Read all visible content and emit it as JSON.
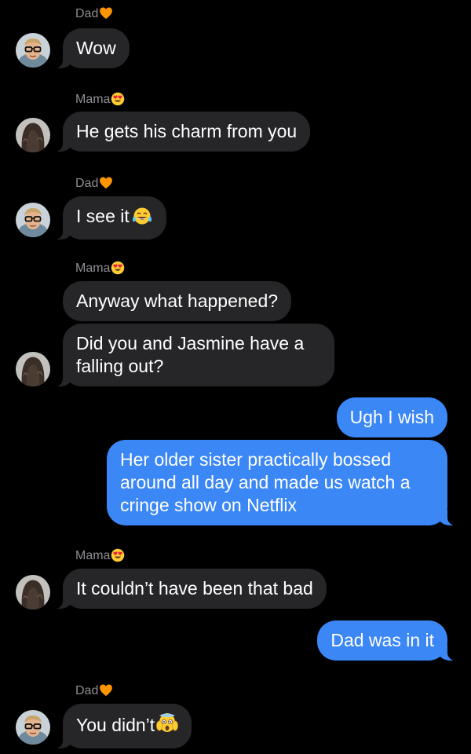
{
  "colors": {
    "background": "#000000",
    "incoming_bubble": "#262629",
    "outgoing_bubble": "#3b87f5",
    "sender_name": "#8e8e93"
  },
  "messages": [
    {
      "sender": "Dad",
      "sender_emoji": "orange-heart-icon",
      "text": "Wow",
      "direction": "incoming"
    },
    {
      "sender": "Mama",
      "sender_emoji": "heart-eyes-icon",
      "text": "He gets his charm from you",
      "direction": "incoming"
    },
    {
      "sender": "Dad",
      "sender_emoji": "orange-heart-icon",
      "text": "I see it",
      "trailing_emoji": "tears-of-joy-icon",
      "direction": "incoming"
    },
    {
      "sender": "Mama",
      "sender_emoji": "heart-eyes-icon",
      "text": "Anyway what happened?",
      "direction": "incoming"
    },
    {
      "text": "Did you and Jasmine have a falling out?",
      "direction": "incoming"
    },
    {
      "text": "Ugh I wish",
      "direction": "outgoing"
    },
    {
      "text": "Her older sister practically bossed around all day and made us watch a cringe show on Netflix",
      "direction": "outgoing"
    },
    {
      "sender": "Mama",
      "sender_emoji": "heart-eyes-icon",
      "text": "It couldn’t have been that bad",
      "direction": "incoming"
    },
    {
      "text": "Dad was in it",
      "direction": "outgoing"
    },
    {
      "sender": "Dad",
      "sender_emoji": "orange-heart-icon",
      "text": "You didn’t",
      "trailing_emoji": "screaming-face-icon",
      "direction": "incoming"
    }
  ]
}
